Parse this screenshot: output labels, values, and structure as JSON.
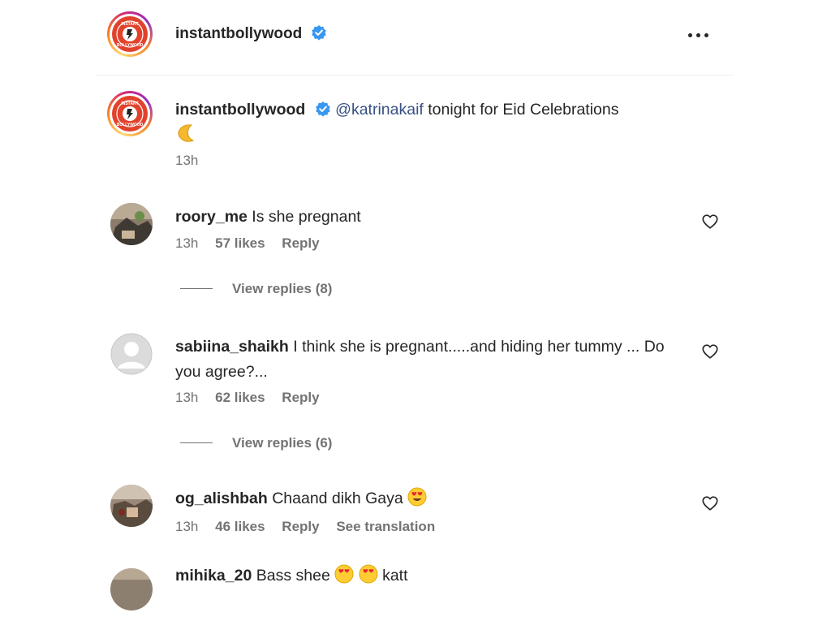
{
  "post": {
    "author": "instantbollywood",
    "logo_text": "Instant Bollywood",
    "caption": {
      "mention": "@katrinakaif",
      "text": " tonight for Eid Celebrations",
      "emoji": "crescent-moon",
      "time": "13h"
    }
  },
  "comments": [
    {
      "username": "roory_me",
      "text": "Is she pregnant",
      "time": "13h",
      "likes": "57 likes",
      "reply": "Reply",
      "view_replies": "View replies (8)"
    },
    {
      "username": "sabiina_shaikh",
      "text": "I think she is pregnant.....and hiding her tummy ... Do you agree?...",
      "time": "13h",
      "likes": "62 likes",
      "reply": "Reply",
      "view_replies": "View replies (6)"
    },
    {
      "username": "og_alishbah",
      "text": "Chaand dikh Gaya",
      "time": "13h",
      "likes": "46 likes",
      "reply": "Reply",
      "translation": "See translation"
    },
    {
      "username": "mihika_20",
      "text": "Bass shee",
      "text_tail": "katt"
    }
  ],
  "colors": {
    "mention": "#385185",
    "verified": "#3897f0",
    "logo_red": "#e2422c",
    "secondary_text": "#737373"
  }
}
